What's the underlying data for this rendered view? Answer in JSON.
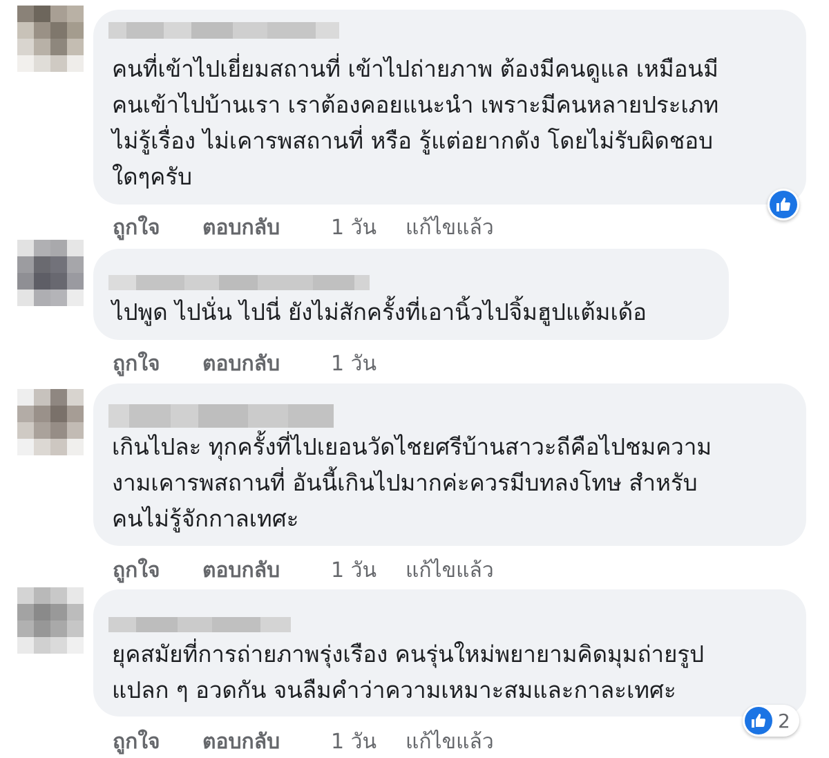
{
  "comments": [
    {
      "text": "คนที่เข้าไปเยี่ยมสถานที่ เข้าไปถ่ายภาพ ต้องมีคนดูแล เหมือนมี\nคนเข้าไปบ้านเรา เราต้องคอยแนะนำ เพราะมีคนหลายประเภท\nไม่รู้เรื่อง ไม่เคารพสถานที่ หรือ รู้แต่อยากดัง โดยไม่รับผิดชอบ\nใดๆครับ",
      "like": "ถูกใจ",
      "reply": "ตอบกลับ",
      "time": "1 วัน",
      "edited": "แก้ไขแล้ว",
      "reaction_icon": "thumbs-up-icon",
      "reaction_count": ""
    },
    {
      "text": "ไปพูด ไปนั่น ไปนี่ ยังไม่สักครั้งที่เอานิ้วไปจิ้มฮูปแต้มเด้อ",
      "like": "ถูกใจ",
      "reply": "ตอบกลับ",
      "time": "1 วัน",
      "edited": ""
    },
    {
      "text": "เกินไปละ ทุกครั้งที่ไปเยอนวัดไชยศรีบ้านสาวะถีคือไปชมความ\nงามเคารพสถานที่ อันนี้เกินไปมากค่ะควรมีบทลงโทษ สำหรับ\nคนไม่รู้จักกาลเทศะ",
      "like": "ถูกใจ",
      "reply": "ตอบกลับ",
      "time": "1 วัน",
      "edited": "แก้ไขแล้ว"
    },
    {
      "text": "ยุคสมัยที่การถ่ายภาพรุ่งเรือง คนรุ่นใหม่พยายามคิดมุมถ่ายรูป\nแปลก ๆ อวดกัน จนลืมคำว่าความเหมาะสมและกาละเทศะ",
      "like": "ถูกใจ",
      "reply": "ตอบกลับ",
      "time": "1 วัน",
      "edited": "แก้ไขแล้ว",
      "reaction_icon": "thumbs-up-icon",
      "reaction_count": "2"
    }
  ],
  "colors": {
    "bubble": "#f0f2f5",
    "text": "#1c1e21",
    "meta": "#65676b",
    "like_blue": "#1b74e4"
  }
}
